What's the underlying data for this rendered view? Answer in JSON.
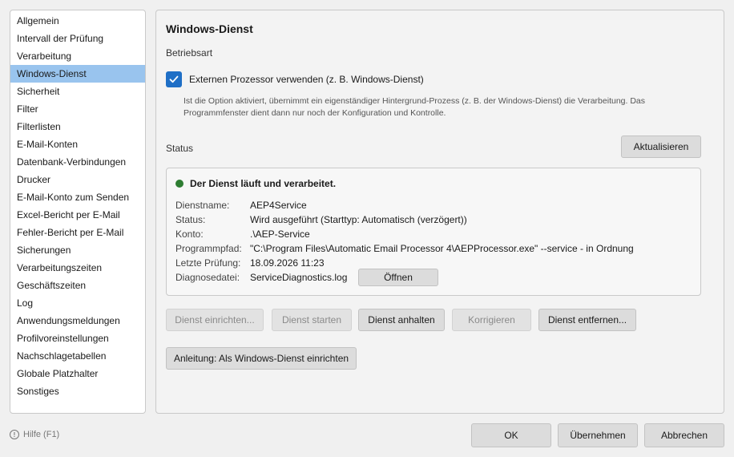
{
  "sidebar": {
    "items": [
      {
        "label": "Allgemein"
      },
      {
        "label": "Intervall der Prüfung"
      },
      {
        "label": "Verarbeitung"
      },
      {
        "label": "Windows-Dienst",
        "selected": true
      },
      {
        "label": "Sicherheit"
      },
      {
        "label": "Filter"
      },
      {
        "label": "Filterlisten"
      },
      {
        "label": "E-Mail-Konten"
      },
      {
        "label": "Datenbank-Verbindungen"
      },
      {
        "label": "Drucker"
      },
      {
        "label": "E-Mail-Konto zum Senden"
      },
      {
        "label": "Excel-Bericht per E-Mail"
      },
      {
        "label": "Fehler-Bericht per E-Mail"
      },
      {
        "label": "Sicherungen"
      },
      {
        "label": "Verarbeitungszeiten"
      },
      {
        "label": "Geschäftszeiten"
      },
      {
        "label": "Log"
      },
      {
        "label": "Anwendungsmeldungen"
      },
      {
        "label": "Profilvoreinstellungen"
      },
      {
        "label": "Nachschlagetabellen"
      },
      {
        "label": "Globale Platzhalter"
      },
      {
        "label": "Sonstiges"
      }
    ]
  },
  "panel": {
    "title": "Windows-Dienst",
    "mode_label": "Betriebsart",
    "checkbox_label": "Externen Prozessor verwenden (z. B. Windows-Dienst)",
    "checkbox_checked": true,
    "description": "Ist die Option aktiviert, übernimmt ein eigenständiger Hintergrund-Prozess (z. B. der Windows-Dienst) die Verarbeitung. Das Programmfenster dient dann nur noch der Konfiguration und Kontrolle.",
    "status_label": "Status",
    "refresh_label": "Aktualisieren",
    "status": {
      "running_text": "Der Dienst läuft und verarbeitet.",
      "dot_color": "#2e7d32",
      "rows": [
        {
          "key": "Dienstname:",
          "value": "AEP4Service"
        },
        {
          "key": "Status:",
          "value": "Wird ausgeführt (Starttyp: Automatisch (verzögert))"
        },
        {
          "key": "Konto:",
          "value": ".\\AEP-Service"
        },
        {
          "key": "Programmpfad:",
          "value": "\"C:\\Program Files\\Automatic Email Processor 4\\AEPProcessor.exe\" --service - in Ordnung"
        },
        {
          "key": "Letzte Prüfung:",
          "value": "18.09.2026 11:23"
        },
        {
          "key": "Diagnosedatei:",
          "value": "ServiceDiagnostics.log"
        }
      ],
      "open_label": "Öffnen"
    },
    "actions": {
      "setup": "Dienst einrichten...",
      "start": "Dienst starten",
      "stop": "Dienst anhalten",
      "fix": "Korrigieren",
      "remove": "Dienst entfernen..."
    },
    "guide_label": "Anleitung: Als Windows-Dienst einrichten"
  },
  "footer": {
    "help_label": "Hilfe (F1)",
    "ok_label": "OK",
    "apply_label": "Übernehmen",
    "cancel_label": "Abbrechen"
  },
  "colors": {
    "selected_item": "#99c4ee",
    "checkbox_accent": "#1f6fc6"
  }
}
